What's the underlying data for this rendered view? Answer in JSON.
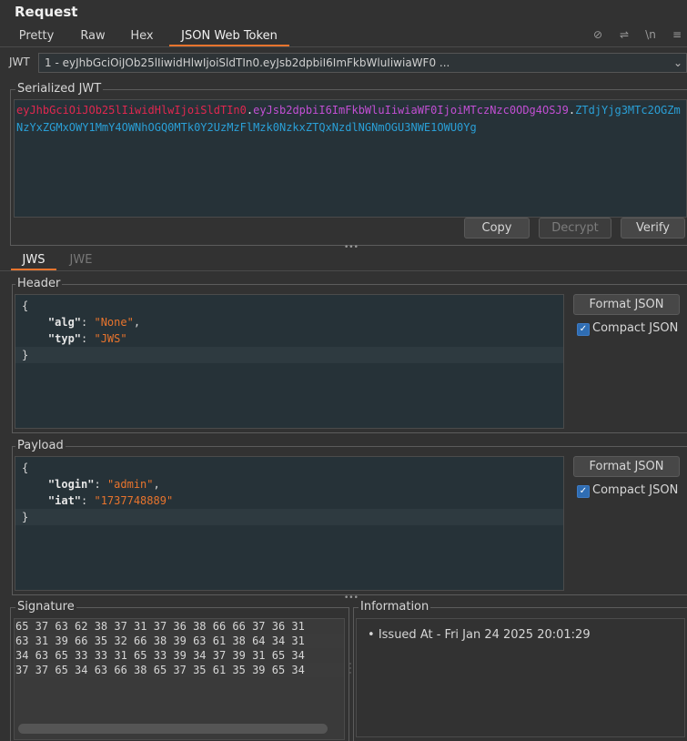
{
  "title": "Request",
  "tabs": [
    "Pretty",
    "Raw",
    "Hex",
    "JSON Web Token"
  ],
  "toolbar_icons": [
    "eye-slash-icon",
    "wrap-icon",
    "newline-icon",
    "menu-icon"
  ],
  "toolbar_glyphs": [
    "⊘",
    "⇌",
    "\\n",
    "≡"
  ],
  "jwt": {
    "label": "JWT",
    "selected": "1 - eyJhbGciOiJOb25lIiwidHlwIjoiSldTIn0.eyJsb2dpbiI6ImFkbWluIiwiaWF0 ..."
  },
  "serialized": {
    "legend": "Serialized JWT",
    "header_part": "eyJhbGciOiJOb25lIiwidHlwIjoiSldTIn0",
    "dot1": ".",
    "payload_part": "eyJsb2dpbiI6ImFkbWluIiwiaWF0IjoiMTczNzc0ODg4OSJ9",
    "dot2": ".",
    "signature_part": "ZTdjYjg3MTc2OGZmNzYxZGMxOWY1MmY4OWNhOGQ0MTk0Y2UzMzFlMzk0NzkxZTQxNzdlNGNmOGU3NWE1OWU0Yg",
    "buttons": [
      "Copy",
      "Decrypt",
      "Verify"
    ],
    "colors": {
      "header": "#e0274f",
      "payload": "#c24fd3",
      "signature": "#2a9fd6"
    }
  },
  "subtabs": [
    "JWS",
    "JWE"
  ],
  "header_section": {
    "legend": "Header",
    "lines": [
      {
        "indent": "",
        "key": "",
        "sep": "",
        "value": "",
        "tail": "{"
      },
      {
        "indent": "    ",
        "key": "\"alg\"",
        "sep": ": ",
        "value": "\"None\"",
        "tail": ","
      },
      {
        "indent": "    ",
        "key": "\"typ\"",
        "sep": ": ",
        "value": "\"JWS\"",
        "tail": ""
      },
      {
        "indent": "",
        "key": "",
        "sep": "",
        "value": "",
        "tail": "}"
      }
    ],
    "format_button": "Format JSON",
    "compact_label": "Compact JSON",
    "compact_checked": true
  },
  "payload_section": {
    "legend": "Payload",
    "lines": [
      {
        "indent": "",
        "key": "",
        "sep": "",
        "value": "",
        "tail": "{"
      },
      {
        "indent": "    ",
        "key": "\"login\"",
        "sep": ": ",
        "value": "\"admin\"",
        "tail": ","
      },
      {
        "indent": "    ",
        "key": "\"iat\"",
        "sep": ": ",
        "value": "\"1737748889\"",
        "tail": ""
      },
      {
        "indent": "",
        "key": "",
        "sep": "",
        "value": "",
        "tail": "}"
      }
    ],
    "format_button": "Format JSON",
    "compact_label": "Compact JSON",
    "compact_checked": true
  },
  "signature_section": {
    "legend": "Signature",
    "rows": [
      "65 37 63 62 38 37 31 37 36 38 66 66 37 36 31",
      "63 31 39 66 35 32 66 38 39 63 61 38 64 34 31",
      "34 63 65 33 33 31 65 33 39 34 37 39 31 65 34",
      "37 37 65 34 63 66 38 65 37 35 61 35 39 65 34"
    ]
  },
  "information_section": {
    "legend": "Information",
    "items": [
      "Issued At - Fri Jan 24 2025 20:01:29"
    ]
  }
}
